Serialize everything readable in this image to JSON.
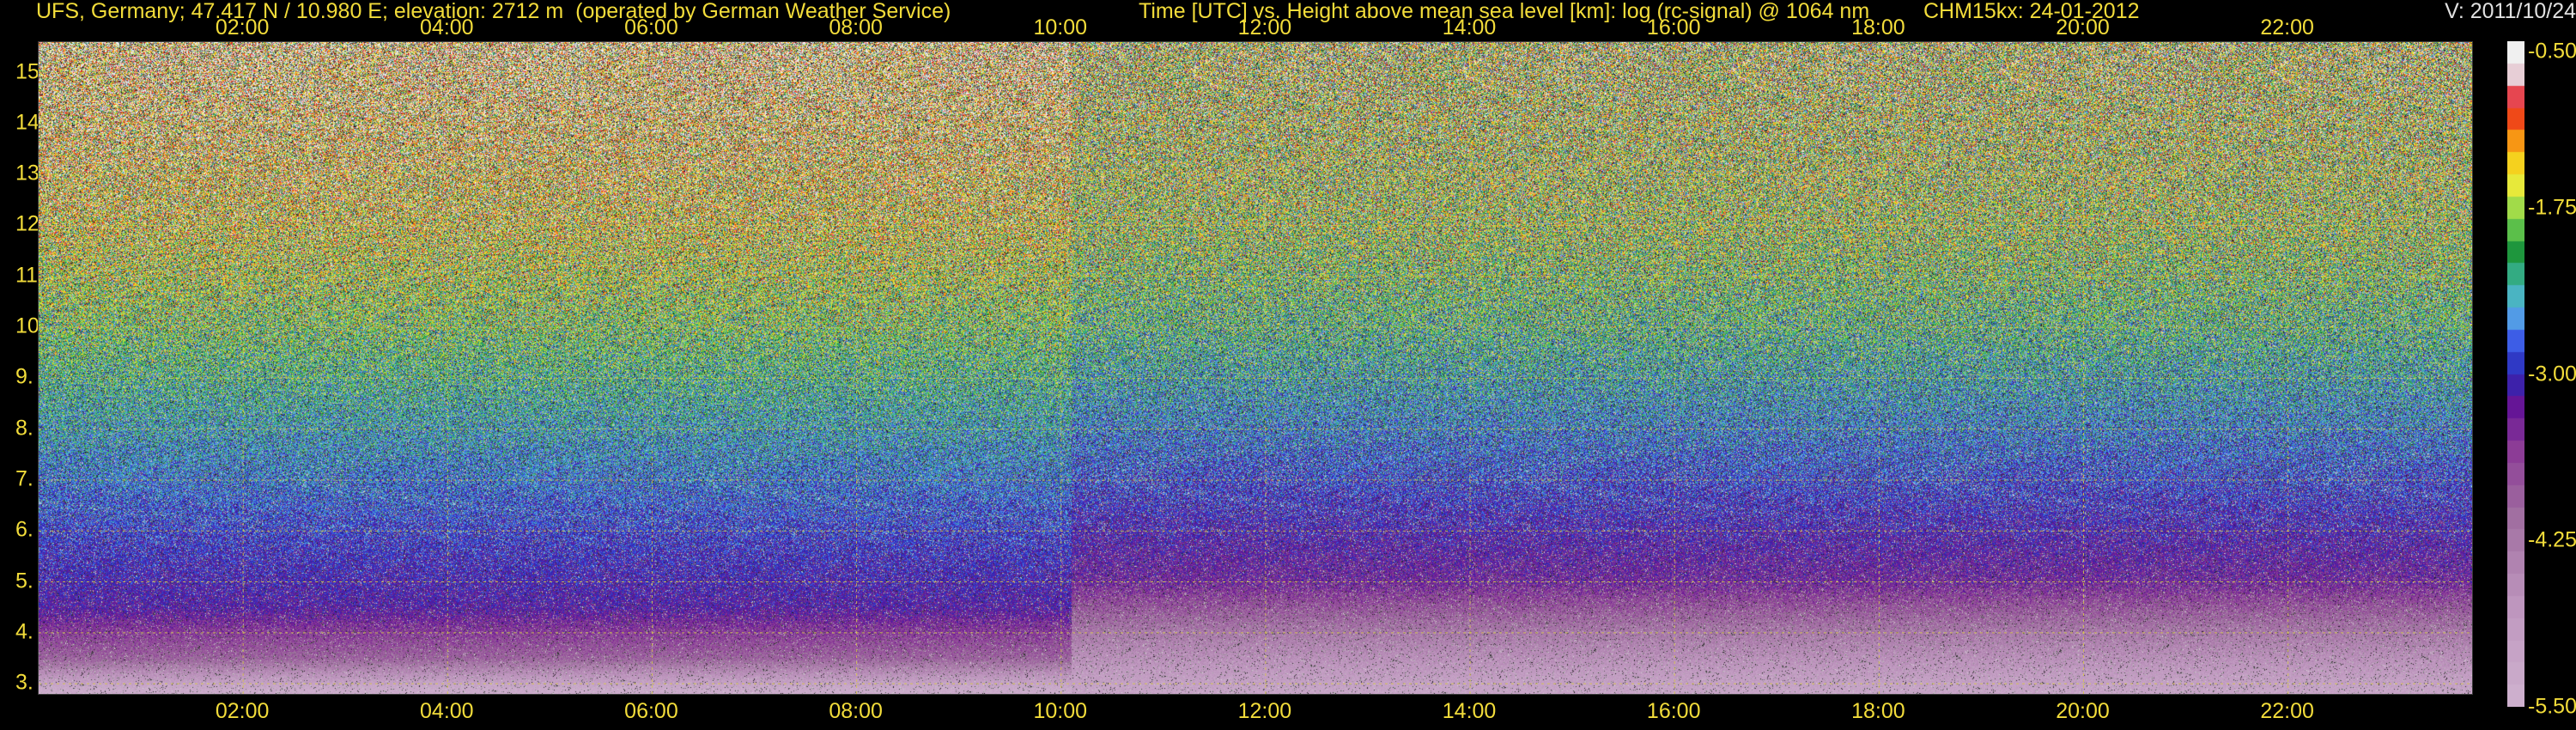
{
  "header": {
    "site": "UFS, Germany; 47.417 N / 10.980 E; elevation: 2712 m  (operated by German Weather Service)",
    "title": "Time [UTC] vs. Height above mean sea level [km]: log (rc-signal) @ 1064 nm",
    "instrument": "CHM15kx: 24-01-2012",
    "version": "V: 2011/10/24"
  },
  "chart_data": {
    "type": "heatmap",
    "title": "Time [UTC] vs. Height above mean sea level [km]: log (rc-signal) @ 1064 nm",
    "xlabel": "Time [UTC]",
    "ylabel": "Height above mean sea level [km]",
    "x_ticks": [
      "02:00",
      "04:00",
      "06:00",
      "08:00",
      "10:00",
      "12:00",
      "14:00",
      "16:00",
      "18:00",
      "20:00",
      "22:00"
    ],
    "x_tick_hours": [
      2,
      4,
      6,
      8,
      10,
      12,
      14,
      16,
      18,
      20,
      22
    ],
    "xlim_hours": [
      0,
      23.8
    ],
    "y_ticks": [
      "3.",
      "4.",
      "5.",
      "6.",
      "7.",
      "8.",
      "9.",
      "10.",
      "11.",
      "12.",
      "13.",
      "14.",
      "15."
    ],
    "y_tick_values": [
      3,
      4,
      5,
      6,
      7,
      8,
      9,
      10,
      11,
      12,
      13,
      14,
      15
    ],
    "ylim": [
      2.8,
      15.6
    ],
    "grid": true,
    "colorbar": {
      "labels": [
        "-0.50",
        "-1.75",
        "-3.00",
        "-4.25",
        "-5.50"
      ],
      "values": [
        -0.5,
        -1.75,
        -3.0,
        -4.25,
        -5.5
      ],
      "range": [
        -5.5,
        -0.5
      ]
    },
    "regime_change_hour": 10.1,
    "profile_mean_before": [
      {
        "height": 2.9,
        "value": -5.4
      },
      {
        "height": 3.5,
        "value": -4.0
      },
      {
        "height": 4.5,
        "value": -3.2
      },
      {
        "height": 6.0,
        "value": -2.9
      },
      {
        "height": 8.0,
        "value": -2.4
      },
      {
        "height": 10.0,
        "value": -1.9
      },
      {
        "height": 12.0,
        "value": -1.4
      },
      {
        "height": 15.5,
        "value": -0.9
      }
    ],
    "profile_mean_after": [
      {
        "height": 2.9,
        "value": -5.2
      },
      {
        "height": 4.0,
        "value": -4.3
      },
      {
        "height": 5.0,
        "value": -3.4
      },
      {
        "height": 6.5,
        "value": -3.0
      },
      {
        "height": 8.0,
        "value": -2.6
      },
      {
        "height": 10.0,
        "value": -2.1
      },
      {
        "height": 12.0,
        "value": -1.7
      },
      {
        "height": 15.5,
        "value": -1.4
      }
    ]
  }
}
